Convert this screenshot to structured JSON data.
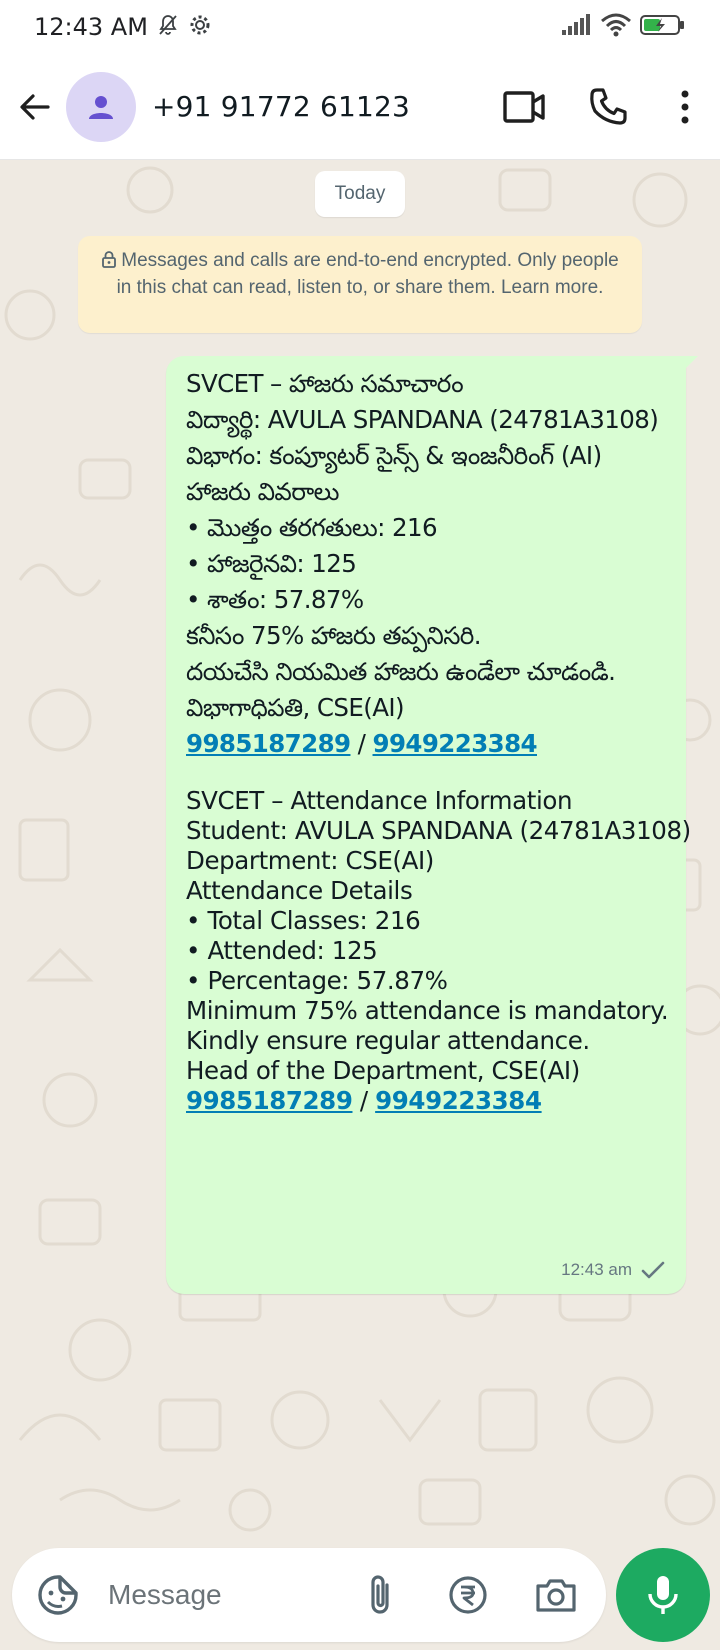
{
  "status_bar": {
    "time": "12:43 AM"
  },
  "header": {
    "contact": "+91 91772 61123"
  },
  "chat": {
    "date_chip": "Today",
    "encryption_notice": "Messages and calls are end-to-end encrypted. Only people in this chat can read, listen to, or share them. Learn more.",
    "message": {
      "telugu_lines": [
        "SVCET – హాజరు సమాచారం",
        "విద్యార్థి: AVULA SPANDANA (24781A3108)",
        "విభాగం: కంప్యూటర్ సైన్స్ & ఇంజనీరింగ్ (AI)",
        "హాజరు వివరాలు",
        "•  మొత్తం తరగతులు: 216",
        "•  హాజరైనవి: 125",
        "•  శాతం: 57.87%",
        "కనీసం 75% హాజరు తప్పనిసరి.",
        "దయచేసి నియమిత హాజరు ఉండేలా చూడండి.",
        "విభాగాధిపతి, CSE(AI)"
      ],
      "english_lines": [
        "SVCET – Attendance Information",
        "Student: AVULA SPANDANA (24781A3108)",
        "Department: CSE(AI)",
        "Attendance Details",
        "•  Total Classes: 216",
        "•  Attended: 125",
        "•  Percentage: 57.87%",
        "Minimum 75% attendance is mandatory.",
        "Kindly ensure regular attendance.",
        "Head of the Department, CSE(AI)"
      ],
      "phone1": "9985187289",
      "separator": " / ",
      "phone2": "9949223384",
      "time": "12:43 am",
      "status": "sent-check-icon"
    }
  },
  "composer": {
    "placeholder": "Message"
  },
  "colors": {
    "chat_bg": "#efeae2",
    "bubble_out": "#d9fdd3",
    "notice_bg": "#fdf0cd",
    "link": "#027eb5",
    "mic_button": "#1daa61",
    "avatar_bg": "#dcd6f5"
  }
}
